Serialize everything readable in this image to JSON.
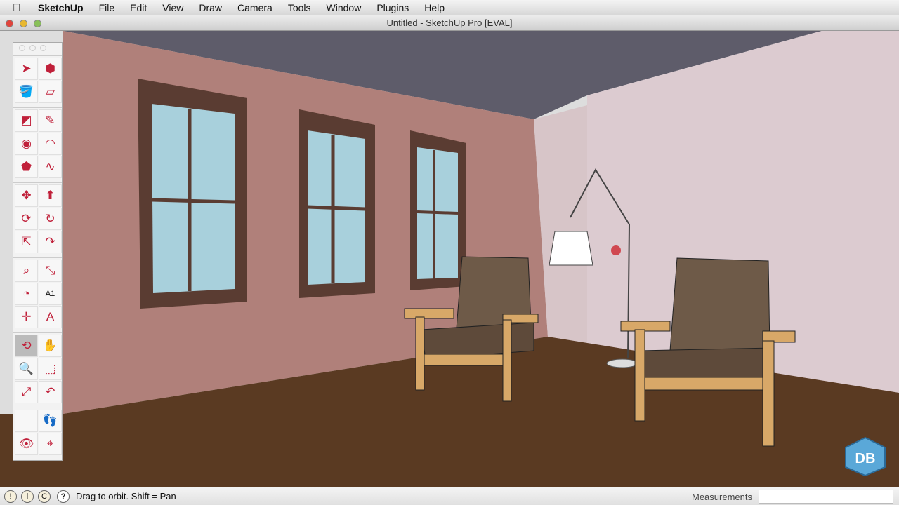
{
  "menubar": {
    "app": "SketchUp",
    "items": [
      "File",
      "Edit",
      "View",
      "Draw",
      "Camera",
      "Tools",
      "Window",
      "Plugins",
      "Help"
    ]
  },
  "window": {
    "title": "Untitled - SketchUp Pro [EVAL]"
  },
  "toolbar": {
    "groups": [
      [
        {
          "icon": "select-icon",
          "glyph": "➤"
        },
        {
          "icon": "make-component-icon",
          "glyph": "⬢"
        },
        {
          "icon": "paint-bucket-icon",
          "glyph": "🪣"
        },
        {
          "icon": "eraser-icon",
          "glyph": "▱"
        }
      ],
      [
        {
          "icon": "rectangle-icon",
          "glyph": "◩"
        },
        {
          "icon": "line-icon",
          "glyph": "✎"
        },
        {
          "icon": "circle-icon",
          "glyph": "◉"
        },
        {
          "icon": "arc-icon",
          "glyph": "◠"
        },
        {
          "icon": "polygon-icon",
          "glyph": "⬟"
        },
        {
          "icon": "freehand-icon",
          "glyph": "∿"
        }
      ],
      [
        {
          "icon": "move-icon",
          "glyph": "✥"
        },
        {
          "icon": "push-pull-icon",
          "glyph": "⬆"
        },
        {
          "icon": "rotate-icon",
          "glyph": "⟳"
        },
        {
          "icon": "follow-me-icon",
          "glyph": "↻"
        },
        {
          "icon": "scale-icon",
          "glyph": "⇱"
        },
        {
          "icon": "offset-icon",
          "glyph": "↷"
        }
      ],
      [
        {
          "icon": "tape-measure-icon",
          "glyph": "⌕"
        },
        {
          "icon": "dimension-icon",
          "glyph": "⤡"
        },
        {
          "icon": "protractor-icon",
          "glyph": "◔"
        },
        {
          "icon": "text-icon",
          "glyph": "A1"
        },
        {
          "icon": "axes-icon",
          "glyph": "✛"
        },
        {
          "icon": "3d-text-icon",
          "glyph": "A"
        }
      ],
      [
        {
          "icon": "orbit-icon",
          "glyph": "⟲",
          "active": true
        },
        {
          "icon": "pan-icon",
          "glyph": "✋"
        },
        {
          "icon": "zoom-icon",
          "glyph": "🔍"
        },
        {
          "icon": "zoom-window-icon",
          "glyph": "⬚"
        },
        {
          "icon": "zoom-extents-icon",
          "glyph": "⤢"
        },
        {
          "icon": "previous-view-icon",
          "glyph": "↶"
        }
      ],
      [
        {
          "icon": "blank-icon",
          "glyph": ""
        },
        {
          "icon": "walk-icon",
          "glyph": "👣"
        },
        {
          "icon": "look-around-icon",
          "glyph": "👁"
        },
        {
          "icon": "position-camera-icon",
          "glyph": "⌖"
        }
      ]
    ]
  },
  "status": {
    "text": "Drag to orbit.  Shift = Pan",
    "help": "?",
    "measurements_label": "Measurements",
    "measurements_value": ""
  },
  "colors": {
    "left_wall": "#b0807a",
    "right_wall": "#dccbd0",
    "ceiling": "#5e5c6a",
    "floor": "#5a3a22",
    "glass": "#a8d0dc",
    "frame": "#5a3c32",
    "chair_seat": "#6e5a48",
    "chair_wood": "#d8a868"
  }
}
